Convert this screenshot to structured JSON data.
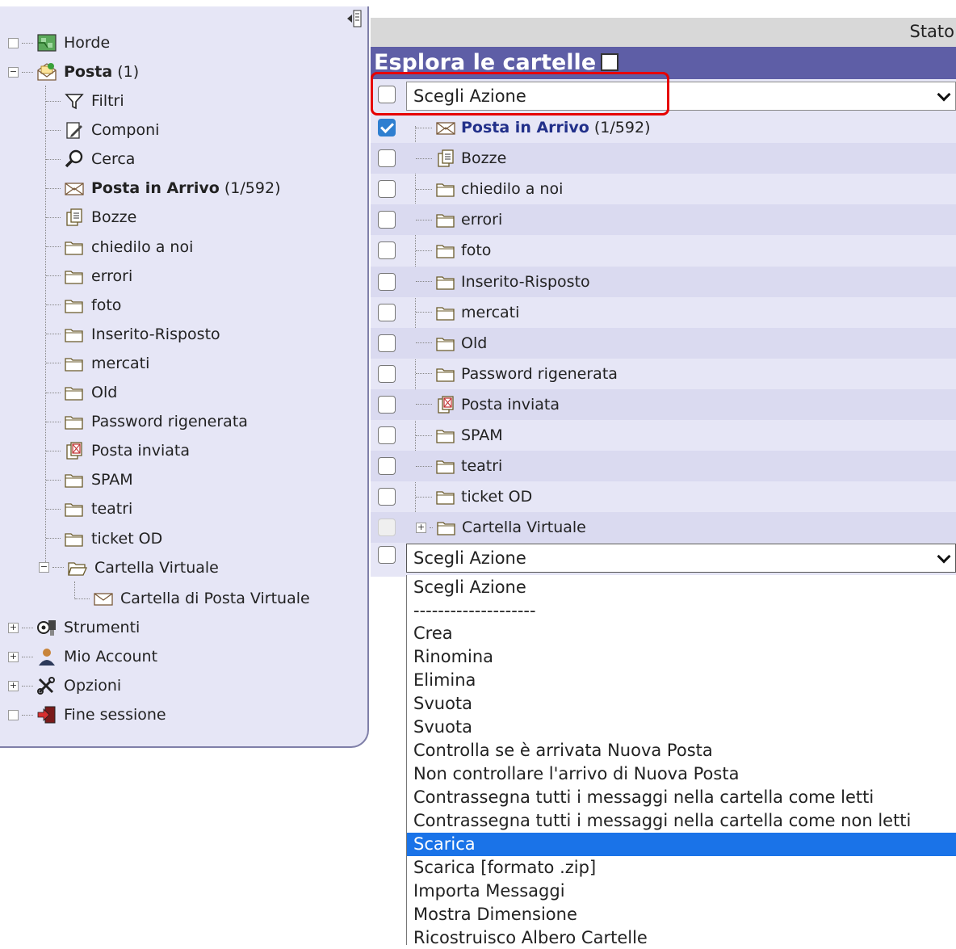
{
  "sidebar": {
    "root": [
      {
        "label": "Horde",
        "icon": "horde-map-icon"
      },
      {
        "label": "Posta",
        "count": "(1)",
        "icon": "mail-open-icon"
      }
    ],
    "posta_children": [
      {
        "label": "Filtri",
        "icon": "filter-icon"
      },
      {
        "label": "Componi",
        "icon": "compose-icon"
      },
      {
        "label": "Cerca",
        "icon": "search-icon"
      },
      {
        "label": "Posta in Arrivo",
        "count": "(1/592)",
        "icon": "inbox-envelope-icon"
      },
      {
        "label": "Bozze",
        "icon": "drafts-icon"
      },
      {
        "label": "chiedilo a noi",
        "icon": "folder-icon"
      },
      {
        "label": "errori",
        "icon": "folder-icon"
      },
      {
        "label": "foto",
        "icon": "folder-icon"
      },
      {
        "label": "Inserito-Risposto",
        "icon": "folder-icon"
      },
      {
        "label": "mercati",
        "icon": "folder-icon"
      },
      {
        "label": "Old",
        "icon": "folder-icon"
      },
      {
        "label": "Password rigenerata",
        "icon": "folder-icon"
      },
      {
        "label": "Posta inviata",
        "icon": "sent-icon"
      },
      {
        "label": "SPAM",
        "icon": "folder-icon"
      },
      {
        "label": "teatri",
        "icon": "folder-icon"
      },
      {
        "label": "ticket OD",
        "icon": "folder-icon"
      },
      {
        "label": "Cartella Virtuale",
        "icon": "folder-open-icon"
      }
    ],
    "virtual_child": {
      "label": "Cartella di Posta Virtuale",
      "icon": "envelope-icon"
    },
    "bottom": [
      {
        "label": "Strumenti",
        "icon": "tools-icon"
      },
      {
        "label": "Mio Account",
        "icon": "user-icon"
      },
      {
        "label": "Opzioni",
        "icon": "options-icon"
      },
      {
        "label": "Fine sessione",
        "icon": "logout-icon"
      }
    ]
  },
  "status_label": "Stato",
  "main_title": "Esplora le cartelle",
  "action_select": {
    "value": "Scegli Azione"
  },
  "folders": [
    {
      "label": "Posta in Arrivo",
      "count": "(1/592)",
      "checked": true,
      "icon": "inbox-envelope-icon"
    },
    {
      "label": "Bozze",
      "icon": "drafts-icon"
    },
    {
      "label": "chiedilo a noi",
      "icon": "folder-icon"
    },
    {
      "label": "errori",
      "icon": "folder-icon"
    },
    {
      "label": "foto",
      "icon": "folder-icon"
    },
    {
      "label": "Inserito-Risposto",
      "icon": "folder-icon"
    },
    {
      "label": "mercati",
      "icon": "folder-icon"
    },
    {
      "label": "Old",
      "icon": "folder-icon"
    },
    {
      "label": "Password rigenerata",
      "icon": "folder-icon"
    },
    {
      "label": "Posta inviata",
      "icon": "sent-icon"
    },
    {
      "label": "SPAM",
      "icon": "folder-icon"
    },
    {
      "label": "teatri",
      "icon": "folder-icon"
    },
    {
      "label": "ticket OD",
      "icon": "folder-icon"
    },
    {
      "label": "Cartella Virtuale",
      "icon": "folder-icon",
      "disabled": true
    }
  ],
  "dropdown_options": [
    "Scegli Azione",
    "--------------------",
    "Crea",
    "Rinomina",
    "Elimina",
    "Svuota",
    "Svuota",
    "Controlla se è arrivata Nuova Posta",
    "Non controllare l'arrivo di Nuova Posta",
    "Contrassegna tutti i messaggi nella cartella come letti",
    "Contrassegna tutti i messaggi nella cartella come non letti",
    "Scarica",
    "Scarica [formato .zip]",
    "Importa Messaggi",
    "Mostra Dimensione",
    "Ricostruisco Albero Cartelle"
  ],
  "dropdown_selected_index": 11,
  "colors": {
    "header": "#5e5ea6",
    "panel": "#e6e6f6",
    "highlight": "#e60000",
    "selected": "#1a73e8"
  }
}
